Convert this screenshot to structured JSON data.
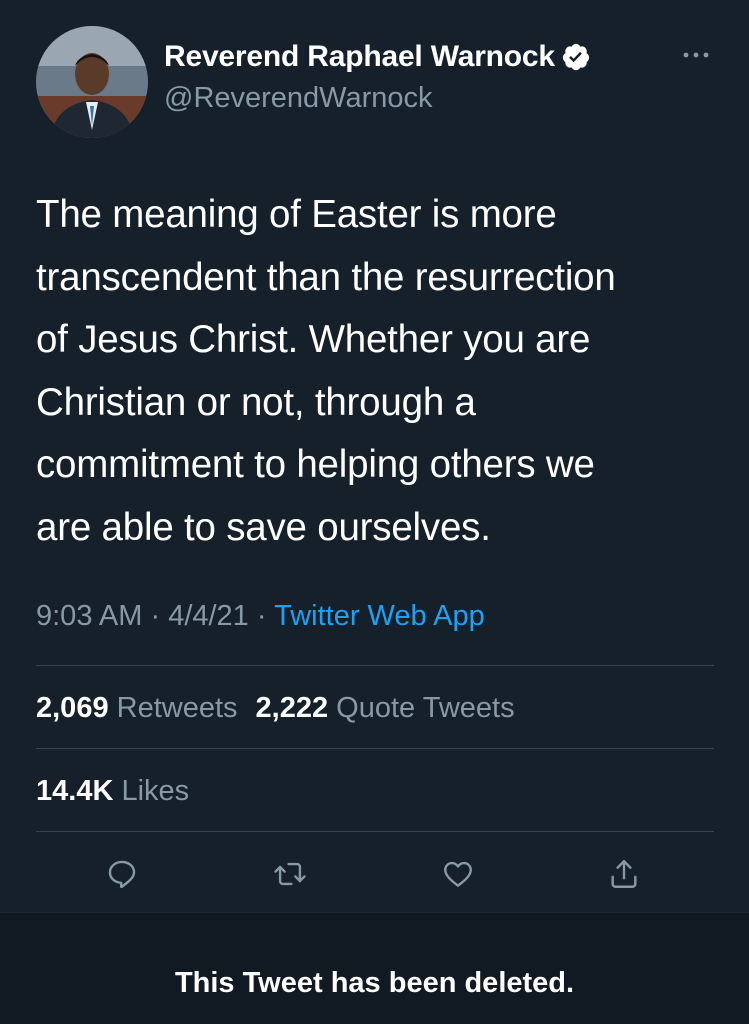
{
  "author": {
    "name": "Reverend Raphael Warnock",
    "handle": "@ReverendWarnock",
    "verified": true,
    "avatar_icon": "profile-photo"
  },
  "tweet": {
    "text_lines": [
      "The meaning of Easter is more",
      "transcendent than the resurrection",
      "of Jesus Christ. Whether you are",
      "Christian or not, through a",
      "commitment to helping others we",
      "are able to save ourselves."
    ],
    "time": "9:03 AM",
    "date": "4/4/21",
    "separator": " · ",
    "source": "Twitter Web App"
  },
  "stats": {
    "retweets_count": "2,069",
    "retweets_label": "Retweets",
    "quotes_count": "2,222",
    "quotes_label": "Quote Tweets",
    "likes_count": "14.4K",
    "likes_label": "Likes"
  },
  "actions": {
    "reply_icon": "reply-icon",
    "retweet_icon": "retweet-icon",
    "like_icon": "heart-icon",
    "share_icon": "share-icon"
  },
  "banner": {
    "message": "This Tweet has been deleted."
  },
  "colors": {
    "background": "#15202b",
    "secondary_text": "#8899a6",
    "link": "#1da1f2",
    "divider": "#38444d"
  }
}
